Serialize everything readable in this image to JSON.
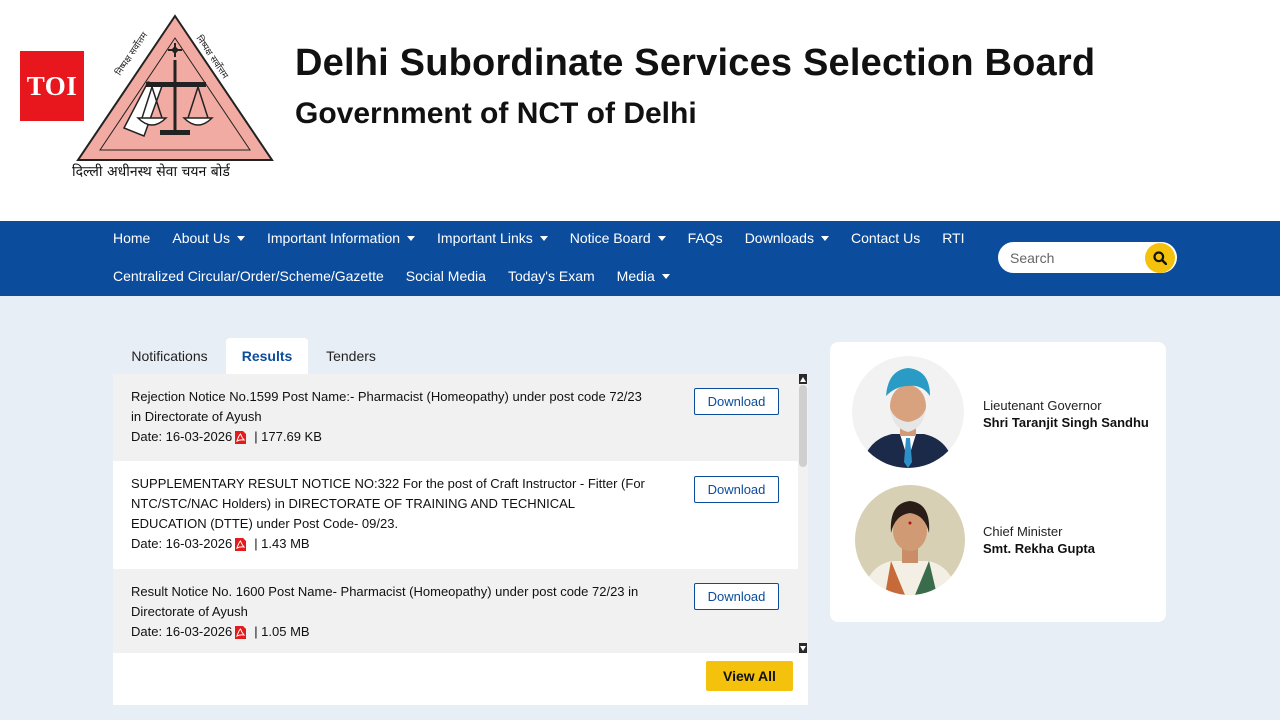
{
  "header": {
    "badge": "TOI",
    "title": "Delhi Subordinate Services Selection Board",
    "subtitle": "Government of NCT of Delhi",
    "emblem_text": "दिल्ली अधीनस्थ सेवा चयन बोर्ड"
  },
  "nav": {
    "row1": [
      {
        "label": "Home",
        "dropdown": false
      },
      {
        "label": "About Us",
        "dropdown": true
      },
      {
        "label": "Important Information",
        "dropdown": true
      },
      {
        "label": "Important Links",
        "dropdown": true
      },
      {
        "label": "Notice Board",
        "dropdown": true
      },
      {
        "label": "FAQs",
        "dropdown": false
      },
      {
        "label": "Downloads",
        "dropdown": true
      },
      {
        "label": "Contact Us",
        "dropdown": false
      },
      {
        "label": "RTI",
        "dropdown": false
      }
    ],
    "row2": [
      {
        "label": "Centralized Circular/Order/Scheme/Gazette",
        "dropdown": false
      },
      {
        "label": "Social Media",
        "dropdown": false
      },
      {
        "label": "Today's Exam",
        "dropdown": false
      },
      {
        "label": "Media",
        "dropdown": true
      }
    ],
    "search_placeholder": "Search"
  },
  "tabs": [
    {
      "label": "Notifications",
      "active": false
    },
    {
      "label": "Results",
      "active": true
    },
    {
      "label": "Tenders",
      "active": false
    }
  ],
  "results": [
    {
      "title": "Rejection Notice No.1599 Post Name:- Pharmacist (Homeopathy) under post code 72/23 in Directorate of Ayush",
      "date": "Date: 16-03-2026",
      "size": "| 177.69 KB",
      "button": "Download"
    },
    {
      "title": "SUPPLEMENTARY RESULT NOTICE NO:322 For the post of Craft Instructor - Fitter (For NTC/STC/NAC Holders) in DIRECTORATE OF TRAINING AND TECHNICAL EDUCATION (DTTE) under Post Code- 09/23.",
      "date": "Date: 16-03-2026",
      "size": "| 1.43 MB",
      "button": "Download"
    },
    {
      "title": "Result Notice No. 1600 Post Name- Pharmacist (Homeopathy) under post code 72/23 in Directorate of Ayush",
      "date": "Date: 16-03-2026",
      "size": "| 1.05 MB",
      "button": "Download"
    }
  ],
  "view_all": "View All",
  "people": [
    {
      "role": "Lieutenant Governor",
      "name": "Shri Taranjit Singh Sandhu"
    },
    {
      "role": "Chief Minister",
      "name": "Smt. Rekha Gupta"
    }
  ],
  "colors": {
    "nav_bg": "#0b4c9c",
    "accent_yellow": "#f4c20d",
    "toi_red": "#e8171e",
    "page_bg": "#e8eef6"
  }
}
